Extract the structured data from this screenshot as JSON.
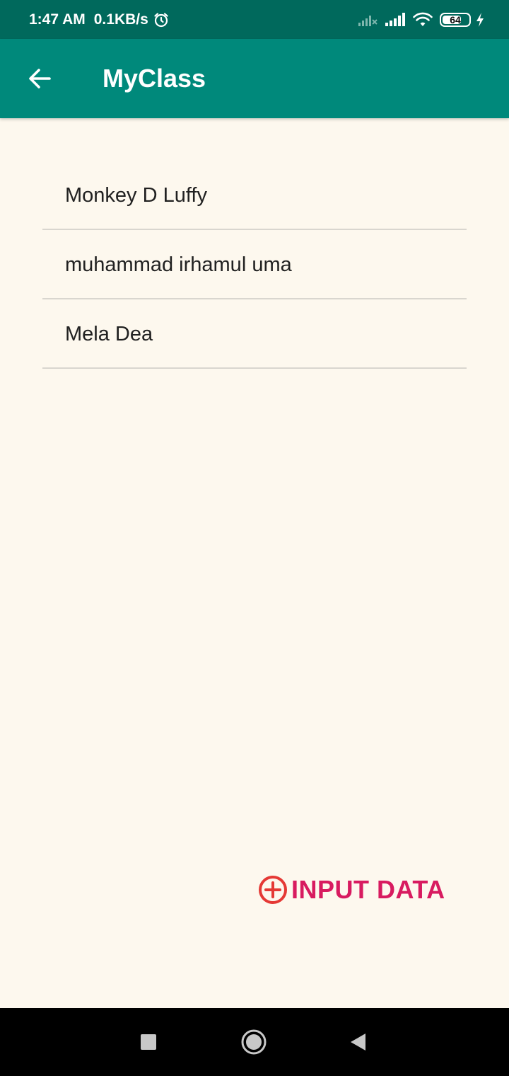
{
  "status_bar": {
    "time": "1:47 AM",
    "speed": "0.1KB/s",
    "battery": "64",
    "icons": [
      "alarm-icon",
      "signal-off-icon",
      "signal-icon",
      "wifi-icon",
      "battery-icon",
      "charging-icon"
    ]
  },
  "app_bar": {
    "title": "MyClass",
    "back_icon": "arrow-left-icon"
  },
  "list": {
    "items": [
      {
        "label": "Monkey D Luffy"
      },
      {
        "label": "muhammad irhamul uma"
      },
      {
        "label": "Mela Dea"
      }
    ]
  },
  "action": {
    "label": "INPUT DATA",
    "icon": "add-circle-icon",
    "color": "#d81b60"
  },
  "nav_bar": {
    "icons": [
      "square-recents-icon",
      "circle-home-icon",
      "triangle-back-icon"
    ]
  },
  "colors": {
    "primary": "#00897b",
    "primary_dark": "#00695c",
    "background": "#fdf8ee",
    "accent": "#d81b60"
  }
}
